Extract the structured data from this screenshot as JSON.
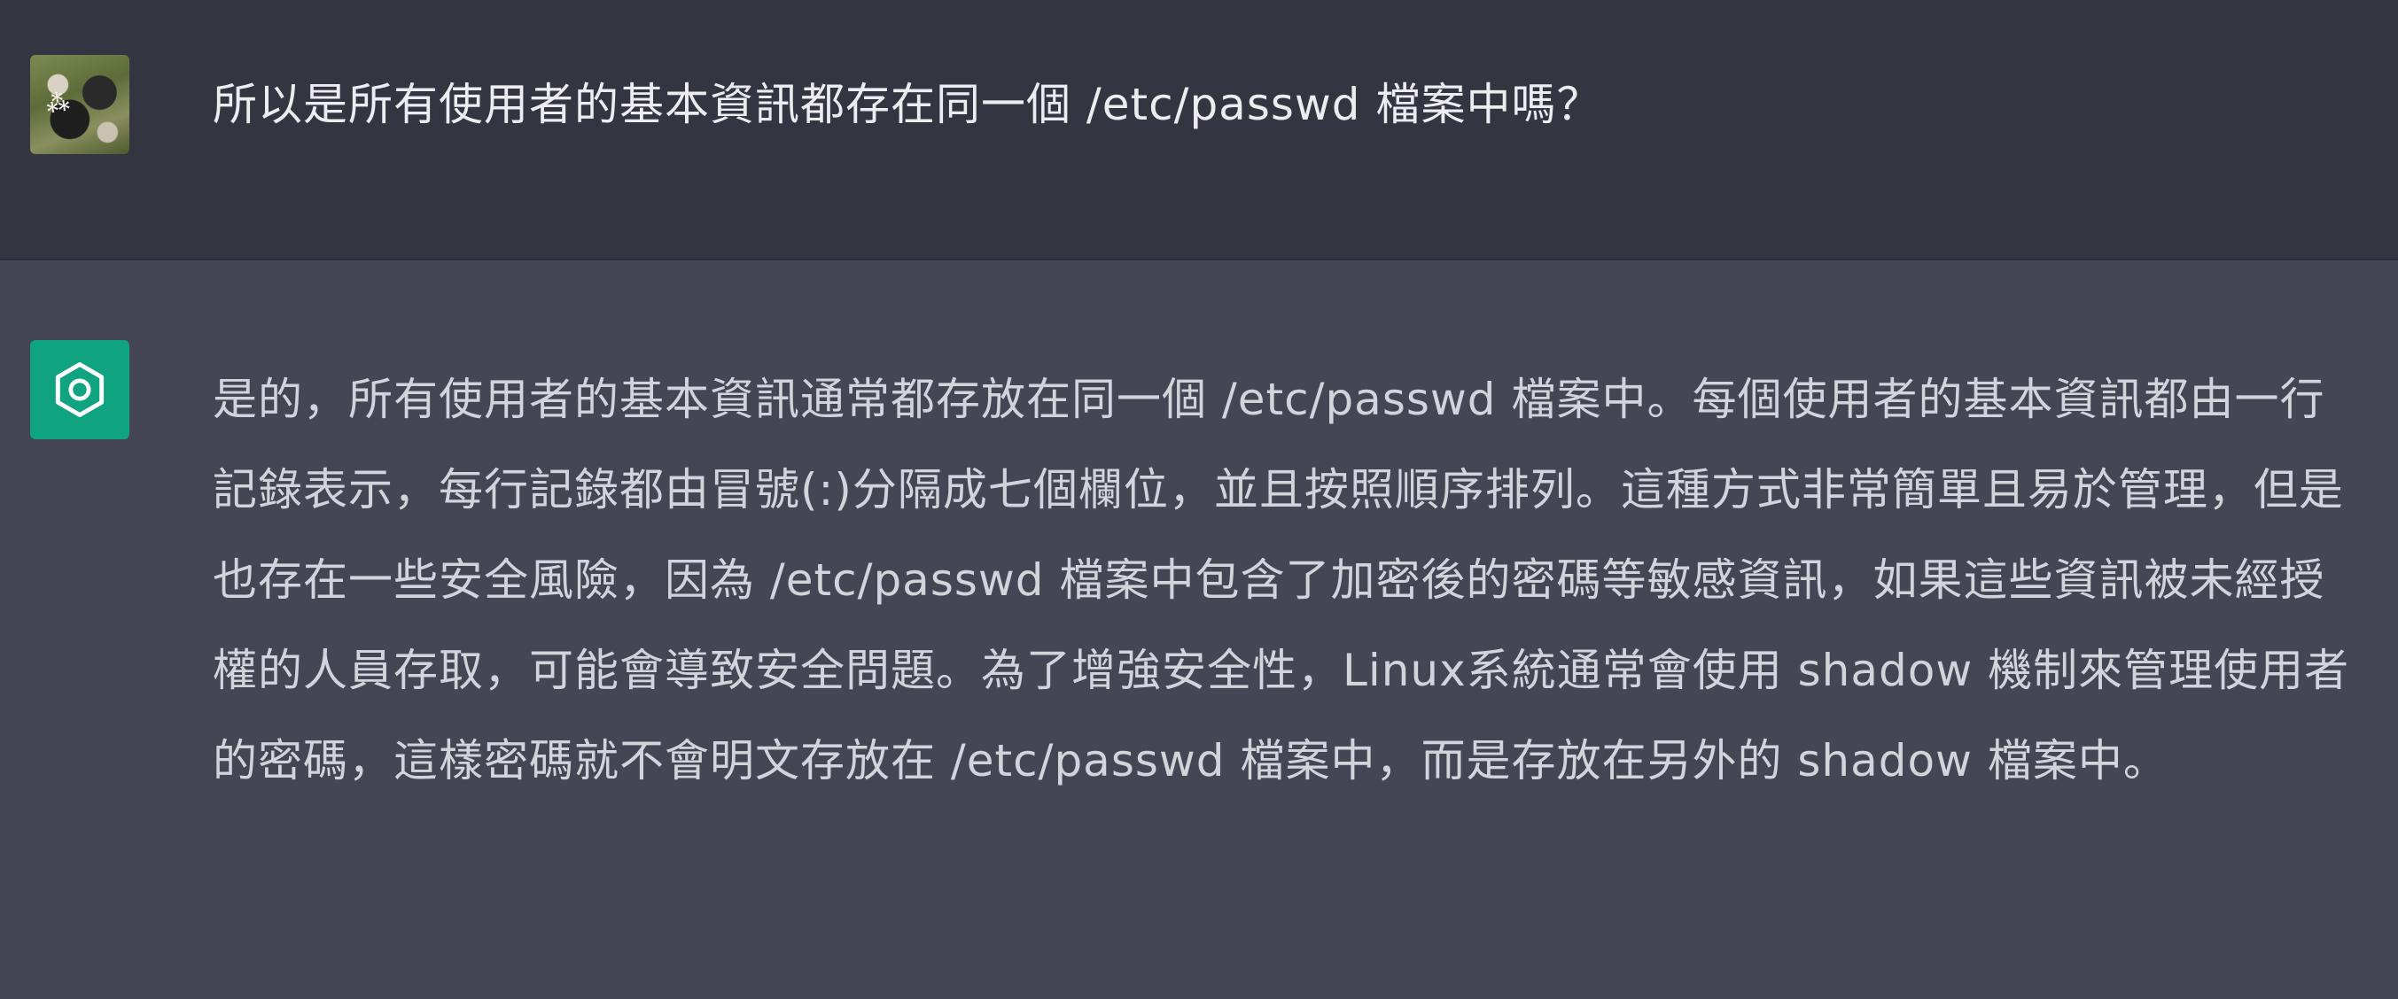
{
  "conversation": {
    "user_message": {
      "avatar_icon": "user-avatar-photo",
      "text": "所以是所有使用者的基本資訊都存在同一個 /etc/passwd 檔案中嗎？"
    },
    "assistant_message": {
      "avatar_icon": "openai-logo-icon",
      "avatar_color": "#10a37f",
      "text": "是的，所有使用者的基本資訊通常都存放在同一個 /etc/passwd 檔案中。每個使用者的基本資訊都由一行記錄表示，每行記錄都由冒號(:)分隔成七個欄位，並且按照順序排列。這種方式非常簡單且易於管理，但是也存在一些安全風險，因為 /etc/passwd 檔案中包含了加密後的密碼等敏感資訊，如果這些資訊被未經授權的人員存取，可能會導致安全問題。為了增強安全性，Linux系統通常會使用 shadow 機制來管理使用者的密碼，這樣密碼就不會明文存放在 /etc/passwd 檔案中，而是存放在另外的 shadow 檔案中。"
    }
  },
  "colors": {
    "user_row_bg": "#343541",
    "assistant_row_bg": "#444654",
    "text": "#ececf1"
  }
}
